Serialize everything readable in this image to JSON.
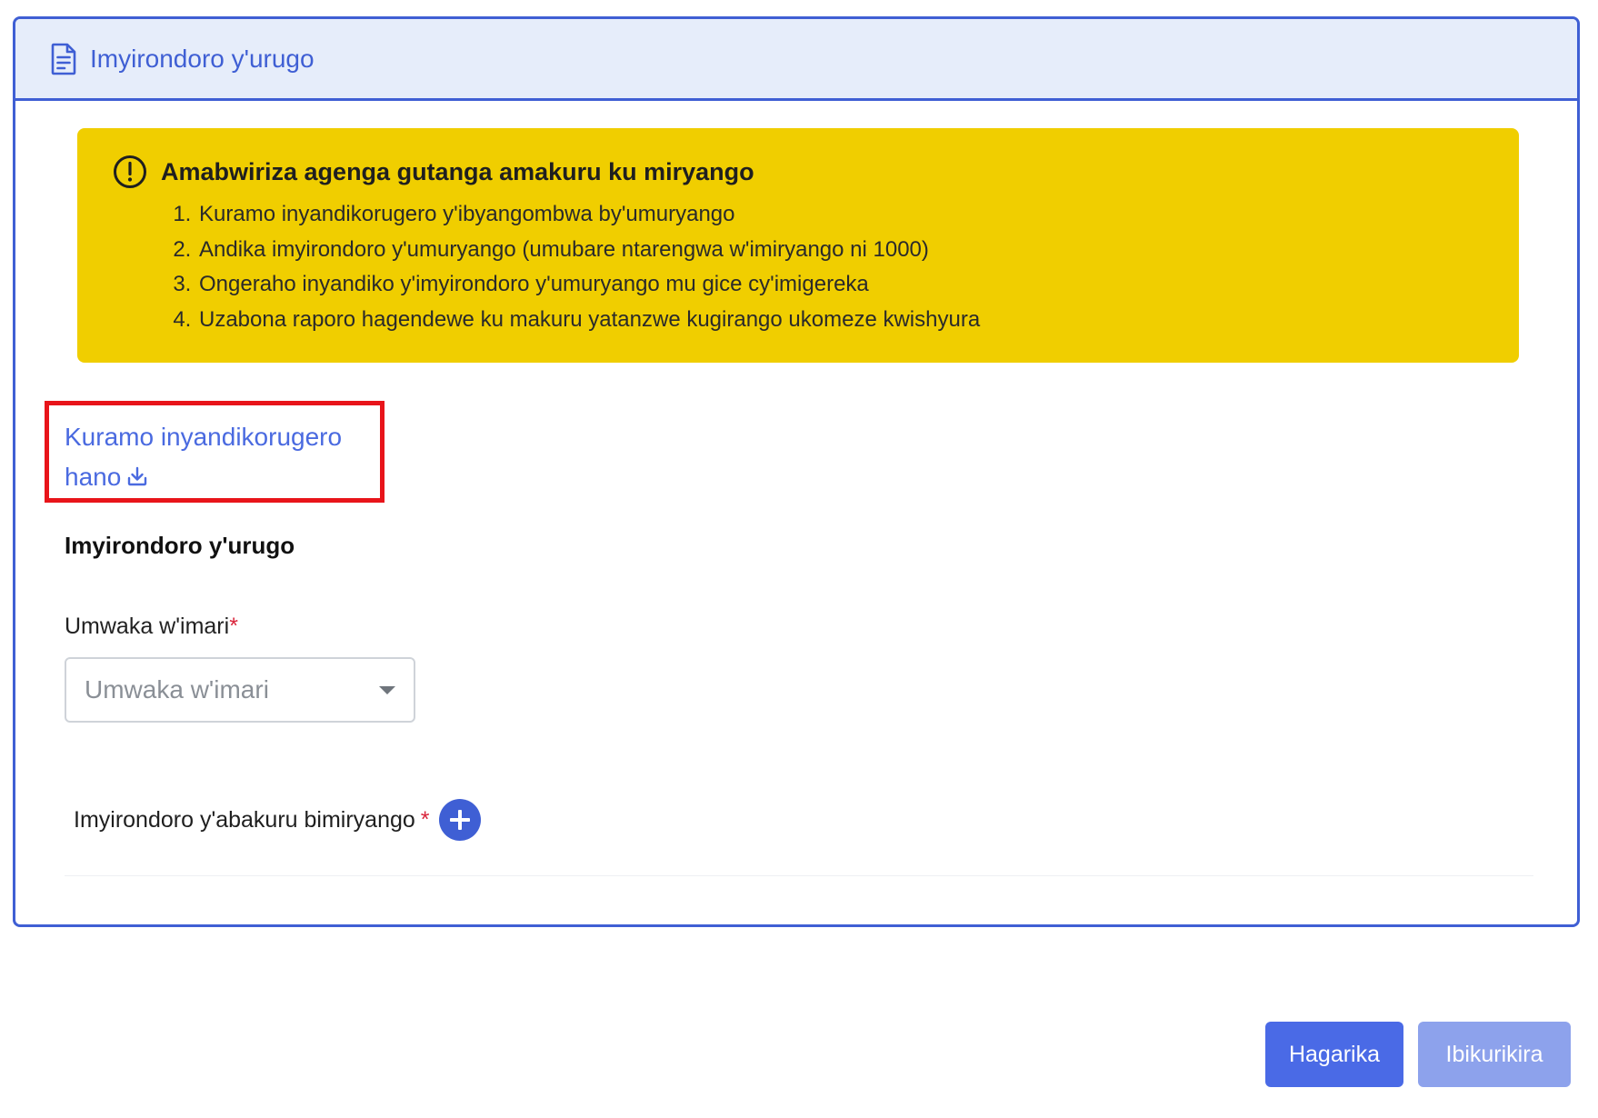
{
  "header": {
    "title": "Imyirondoro y'urugo",
    "icon": "document-icon"
  },
  "notice": {
    "icon": "exclamation-circle-icon",
    "title": "Amabwiriza agenga gutanga amakuru ku miryango",
    "items": [
      "Kuramo inyandikorugero y'ibyangombwa by'umuryango",
      "Andika imyirondoro y'umuryango (umubare ntarengwa w'imiryango ni 1000)",
      "Ongeraho inyandiko y'imyirondoro y'umuryango mu gice cy'imigereka",
      "Uzabona raporo hagendewe ku makuru yatanzwe kugirango ukomeze kwishyura"
    ],
    "color": "#f0ce00"
  },
  "download": {
    "label_line1": "Kuramo inyandikorugero",
    "label_line2": "hano",
    "icon": "download-icon"
  },
  "form": {
    "section_title": "Imyirondoro y'urugo",
    "fiscal_year": {
      "label": "Umwaka w'imari",
      "required_mark": "*",
      "placeholder": "Umwaka w'imari"
    },
    "household_list": {
      "label": "Imyirondoro y'abakuru bimiryango",
      "required_mark": "*",
      "add_icon": "plus-icon"
    }
  },
  "actions": {
    "cancel_label": "Hagarika",
    "confirm_label": "Ibikurikira"
  },
  "colors": {
    "accent": "#3f5fd4",
    "highlight_border": "#e8141a",
    "required": "#d9253b"
  }
}
